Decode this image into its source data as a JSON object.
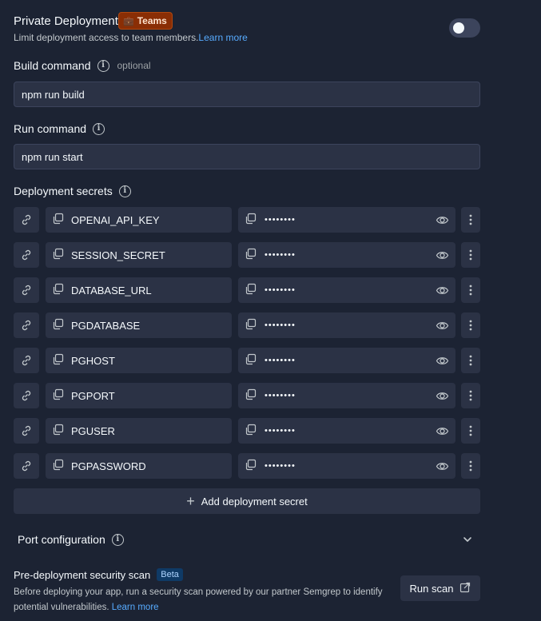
{
  "private_deployment": {
    "title": "Private Deployment",
    "badge": "Teams",
    "description": "Limit deployment access to team members.",
    "learn_more": "Learn more",
    "toggle_on": false
  },
  "build_command": {
    "label": "Build command",
    "optional": "optional",
    "value": "npm run build"
  },
  "run_command": {
    "label": "Run command",
    "value": "npm run start"
  },
  "secrets": {
    "label": "Deployment secrets",
    "masked_value": "••••••••",
    "items": [
      {
        "key": "OPENAI_API_KEY"
      },
      {
        "key": "SESSION_SECRET"
      },
      {
        "key": "DATABASE_URL"
      },
      {
        "key": "PGDATABASE"
      },
      {
        "key": "PGHOST"
      },
      {
        "key": "PGPORT"
      },
      {
        "key": "PGUSER"
      },
      {
        "key": "PGPASSWORD"
      }
    ],
    "add_label": "Add deployment secret"
  },
  "port_configuration": {
    "label": "Port configuration"
  },
  "security_scan": {
    "title": "Pre-deployment security scan",
    "badge": "Beta",
    "description": "Before deploying your app, run a security scan powered by our partner Semgrep to identify potential vulnerabilities.",
    "learn_more": "Learn more",
    "button": "Run scan"
  },
  "colors": {
    "background": "#1c2333",
    "surface": "#2b3245",
    "link": "#57abff",
    "teams_badge": "#8a2e05"
  }
}
